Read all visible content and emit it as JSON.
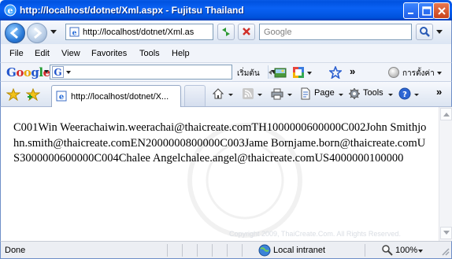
{
  "window": {
    "title": "http://localhost/dotnet/Xml.aspx - Fujitsu Thailand"
  },
  "address_bar": {
    "url": "http://localhost/dotnet/Xml.aspx",
    "search_placeholder": "Google"
  },
  "menu": [
    "File",
    "Edit",
    "View",
    "Favorites",
    "Tools",
    "Help"
  ],
  "google_toolbar": {
    "logo": "Google",
    "input_icon": "G",
    "search_label": "เริ่มต้น",
    "settings_label": "การตั้งค่า",
    "more": "»"
  },
  "tabs": {
    "active_title": "http://localhost/dotnet/X..."
  },
  "commands": {
    "page_label": "Page",
    "tools_label": "Tools",
    "more": "»"
  },
  "page": {
    "content": "C001Win Weerachaiwin.weerachai@thaicreate.comTH1000000600000C002John Smithjohn.smith@thaicreate.comEN2000000800000C003Jame Bornjame.born@thaicreate.comUS3000000600000C004Chalee Angelchalee.angel@thaicreate.comUS4000000100000",
    "watermark_copyright": "Copyright 2009, ThaiCreate.Com. All Rights Reserved."
  },
  "status": {
    "text": "Done",
    "zone": "Local intranet",
    "zoom": "100%"
  },
  "colors": {
    "titlebar": "#0a62f4",
    "chrome": "#dbe5f3",
    "frame_border": "#6f8fc8"
  }
}
